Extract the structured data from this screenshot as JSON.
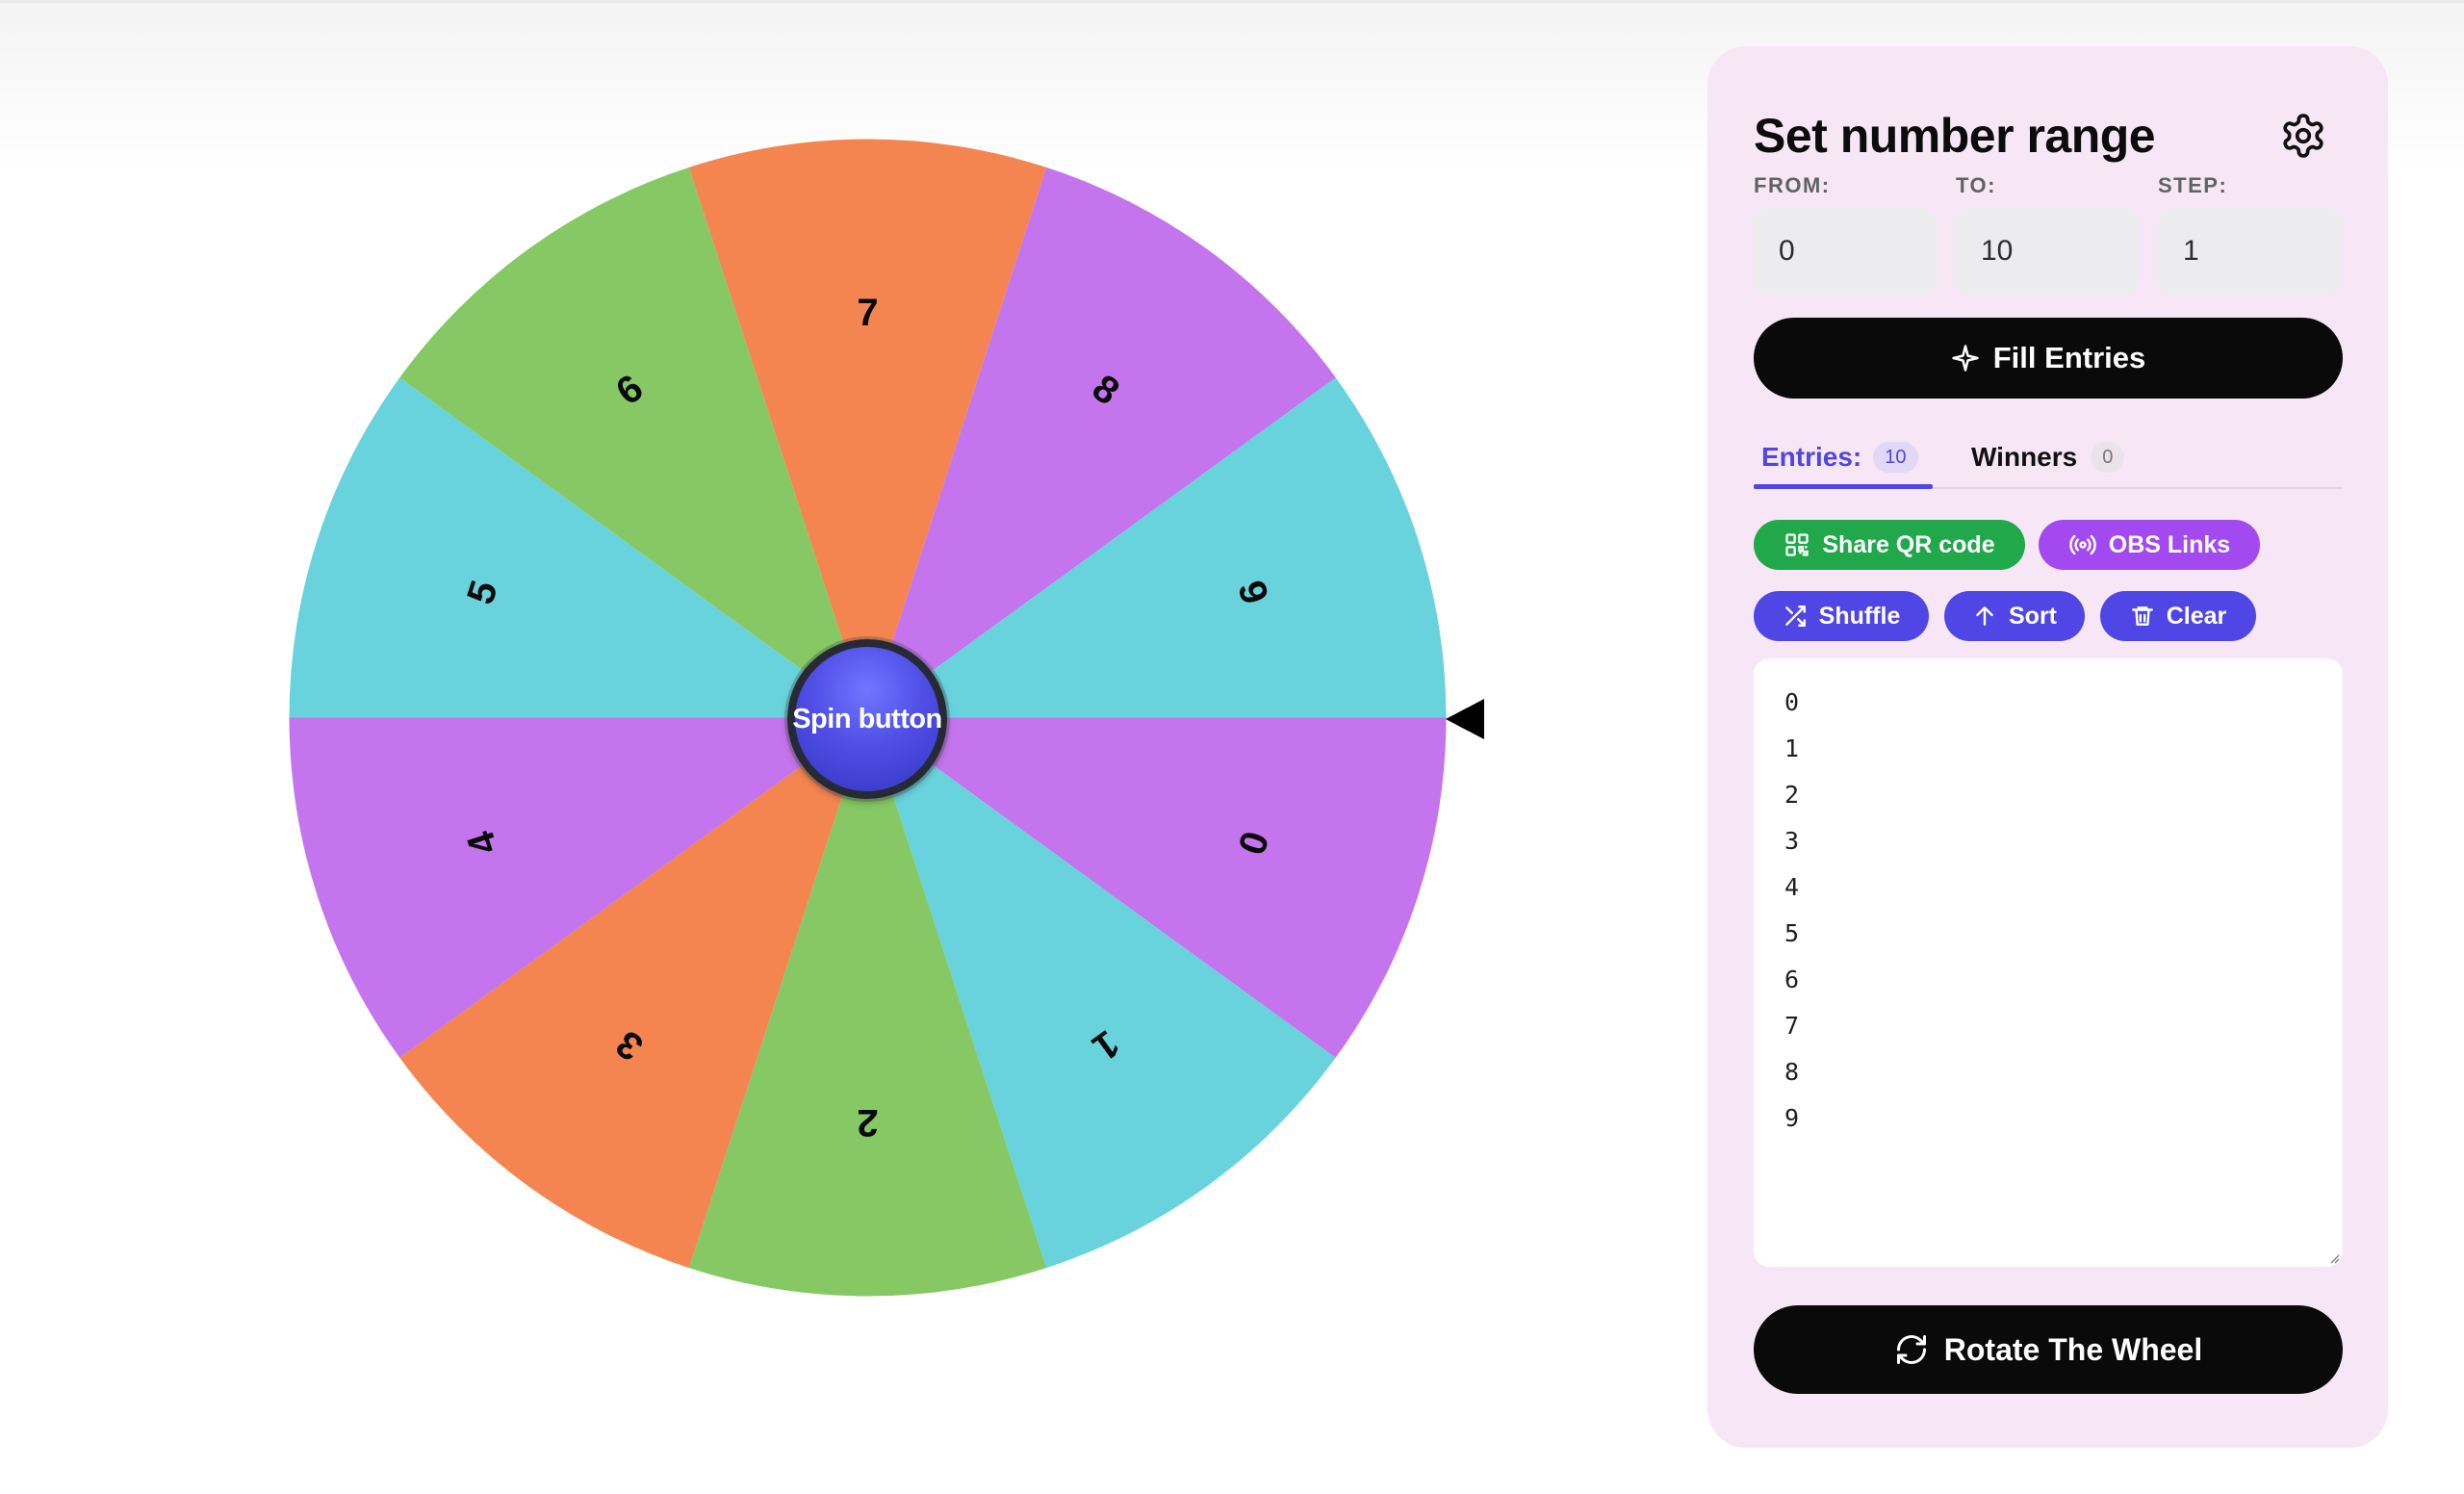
{
  "wheel": {
    "spin_label": "Spin button",
    "slices": [
      {
        "label": "0",
        "color": "#c474ec"
      },
      {
        "label": "1",
        "color": "#68d3dc"
      },
      {
        "label": "2",
        "color": "#86c964"
      },
      {
        "label": "3",
        "color": "#f48551"
      },
      {
        "label": "4",
        "color": "#c474ec"
      },
      {
        "label": "5",
        "color": "#68d3dc"
      },
      {
        "label": "6",
        "color": "#86c964"
      },
      {
        "label": "7",
        "color": "#f48551"
      },
      {
        "label": "8",
        "color": "#c474ec"
      },
      {
        "label": "9",
        "color": "#68d3dc"
      }
    ]
  },
  "panel": {
    "title": "Set number range",
    "settings_icon": "gear-icon",
    "range": {
      "from_label": "FROM:",
      "from_value": "0",
      "to_label": "TO:",
      "to_value": "10",
      "step_label": "STEP:",
      "step_value": "1"
    },
    "fill_label": "Fill Entries",
    "tabs": {
      "entries_label": "Entries:",
      "entries_count": "10",
      "winners_label": "Winners",
      "winners_count": "0"
    },
    "actions": {
      "share_qr": "Share QR code",
      "obs_links": "OBS Links",
      "shuffle": "Shuffle",
      "sort": "Sort",
      "clear": "Clear"
    },
    "entries": [
      "0",
      "1",
      "2",
      "3",
      "4",
      "5",
      "6",
      "7",
      "8",
      "9"
    ],
    "rotate_label": "Rotate The Wheel"
  },
  "colors": {
    "panel_bg": "#f7e6f6",
    "accent": "#4f46e5",
    "green": "#20a84a",
    "purple": "#a24af0",
    "black": "#0a0a0a"
  }
}
